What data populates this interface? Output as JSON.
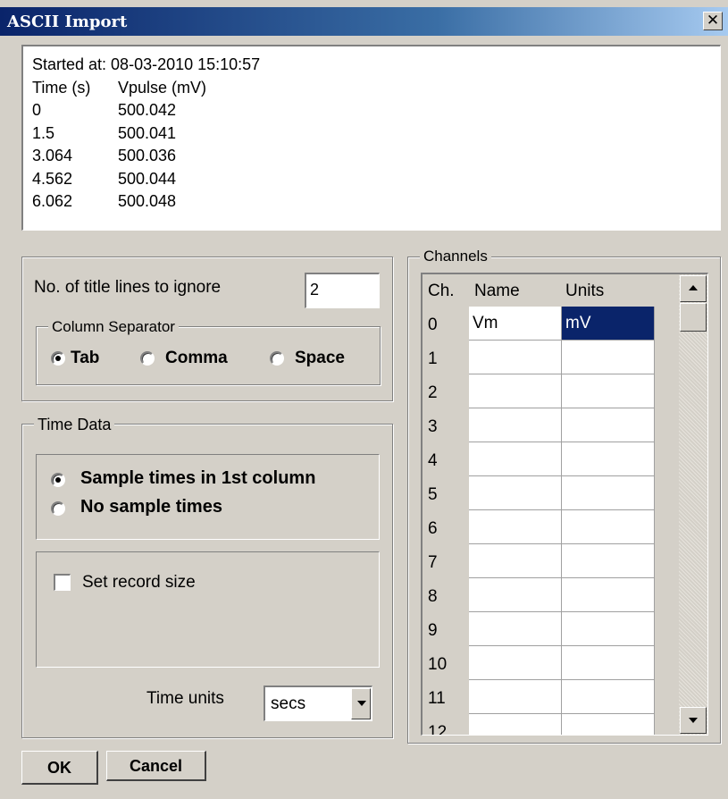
{
  "window": {
    "title": "ASCII Import",
    "close_glyph": "✕",
    "close_icon": "close-icon"
  },
  "preview": {
    "lines": [
      {
        "c1": "Started at: 08-03-2010 15:10:57",
        "c2": ""
      },
      {
        "c1": "Time (s)",
        "c2": "Vpulse (mV)"
      },
      {
        "c1": "0",
        "c2": "500.042"
      },
      {
        "c1": "1.5",
        "c2": "500.041"
      },
      {
        "c1": "3.064",
        "c2": "500.036"
      },
      {
        "c1": "4.562",
        "c2": "500.044"
      },
      {
        "c1": "6.062",
        "c2": "500.048"
      }
    ]
  },
  "format": {
    "title_lines_label": "No. of title lines to ignore",
    "title_lines_value": "2",
    "separator_group_label": "Column Separator",
    "separators": [
      {
        "label": "Tab",
        "selected": true
      },
      {
        "label": "Comma",
        "selected": false
      },
      {
        "label": "Space",
        "selected": false
      }
    ]
  },
  "time_data": {
    "group_label": "Time Data",
    "options": [
      {
        "label": "Sample times in 1st column",
        "selected": true
      },
      {
        "label": "No sample times",
        "selected": false
      }
    ],
    "set_record_size_label": "Set record size",
    "set_record_size_checked": false,
    "time_units_label": "Time units",
    "time_units_value": "secs"
  },
  "channels": {
    "group_label": "Channels",
    "headers": {
      "ch": "Ch.",
      "name": "Name",
      "units": "Units"
    },
    "rows": [
      {
        "ch": "0",
        "name": "Vm",
        "units": "mV",
        "selected_units": true
      },
      {
        "ch": "1",
        "name": "",
        "units": ""
      },
      {
        "ch": "2",
        "name": "",
        "units": ""
      },
      {
        "ch": "3",
        "name": "",
        "units": ""
      },
      {
        "ch": "4",
        "name": "",
        "units": ""
      },
      {
        "ch": "5",
        "name": "",
        "units": ""
      },
      {
        "ch": "6",
        "name": "",
        "units": ""
      },
      {
        "ch": "7",
        "name": "",
        "units": ""
      },
      {
        "ch": "8",
        "name": "",
        "units": ""
      },
      {
        "ch": "9",
        "name": "",
        "units": ""
      },
      {
        "ch": "10",
        "name": "",
        "units": ""
      },
      {
        "ch": "11",
        "name": "",
        "units": ""
      },
      {
        "ch": "12",
        "name": "",
        "units": ""
      }
    ],
    "selection_color": "#0a246a"
  },
  "buttons": {
    "ok": "OK",
    "cancel": "Cancel"
  },
  "colors": {
    "titlebar": "#0a246a",
    "face": "#d4d0c8"
  }
}
